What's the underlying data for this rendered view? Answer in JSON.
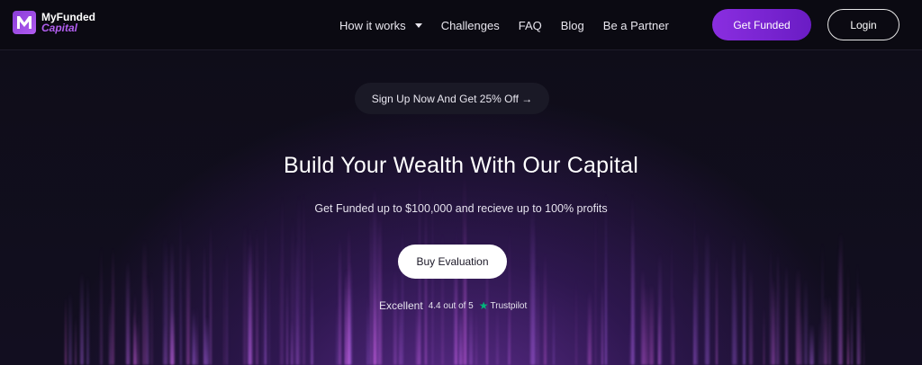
{
  "header": {
    "logo_line1": "MyFunded",
    "logo_line2": "Capital",
    "nav": [
      {
        "label": "How it works",
        "has_dropdown": true
      },
      {
        "label": "Challenges"
      },
      {
        "label": "FAQ"
      },
      {
        "label": "Blog"
      },
      {
        "label": "Be a Partner"
      }
    ],
    "get_funded_label": "Get Funded",
    "login_label": "Login"
  },
  "hero": {
    "promo_label": "Sign Up Now And Get 25% Off →",
    "title": "Build Your Wealth With Our Capital",
    "subtitle": "Get Funded up to $100,000 and recieve up to 100% profits",
    "cta_label": "Buy Evaluation"
  },
  "trust": {
    "excellent": "Excellent",
    "rating": "4.4 out of 5",
    "brand": "Trustpilot"
  },
  "colors": {
    "accent": "#8a2ee0",
    "logo_purple": "#b25ff0",
    "trustpilot_green": "#00b67a",
    "background": "#0d0b17"
  }
}
